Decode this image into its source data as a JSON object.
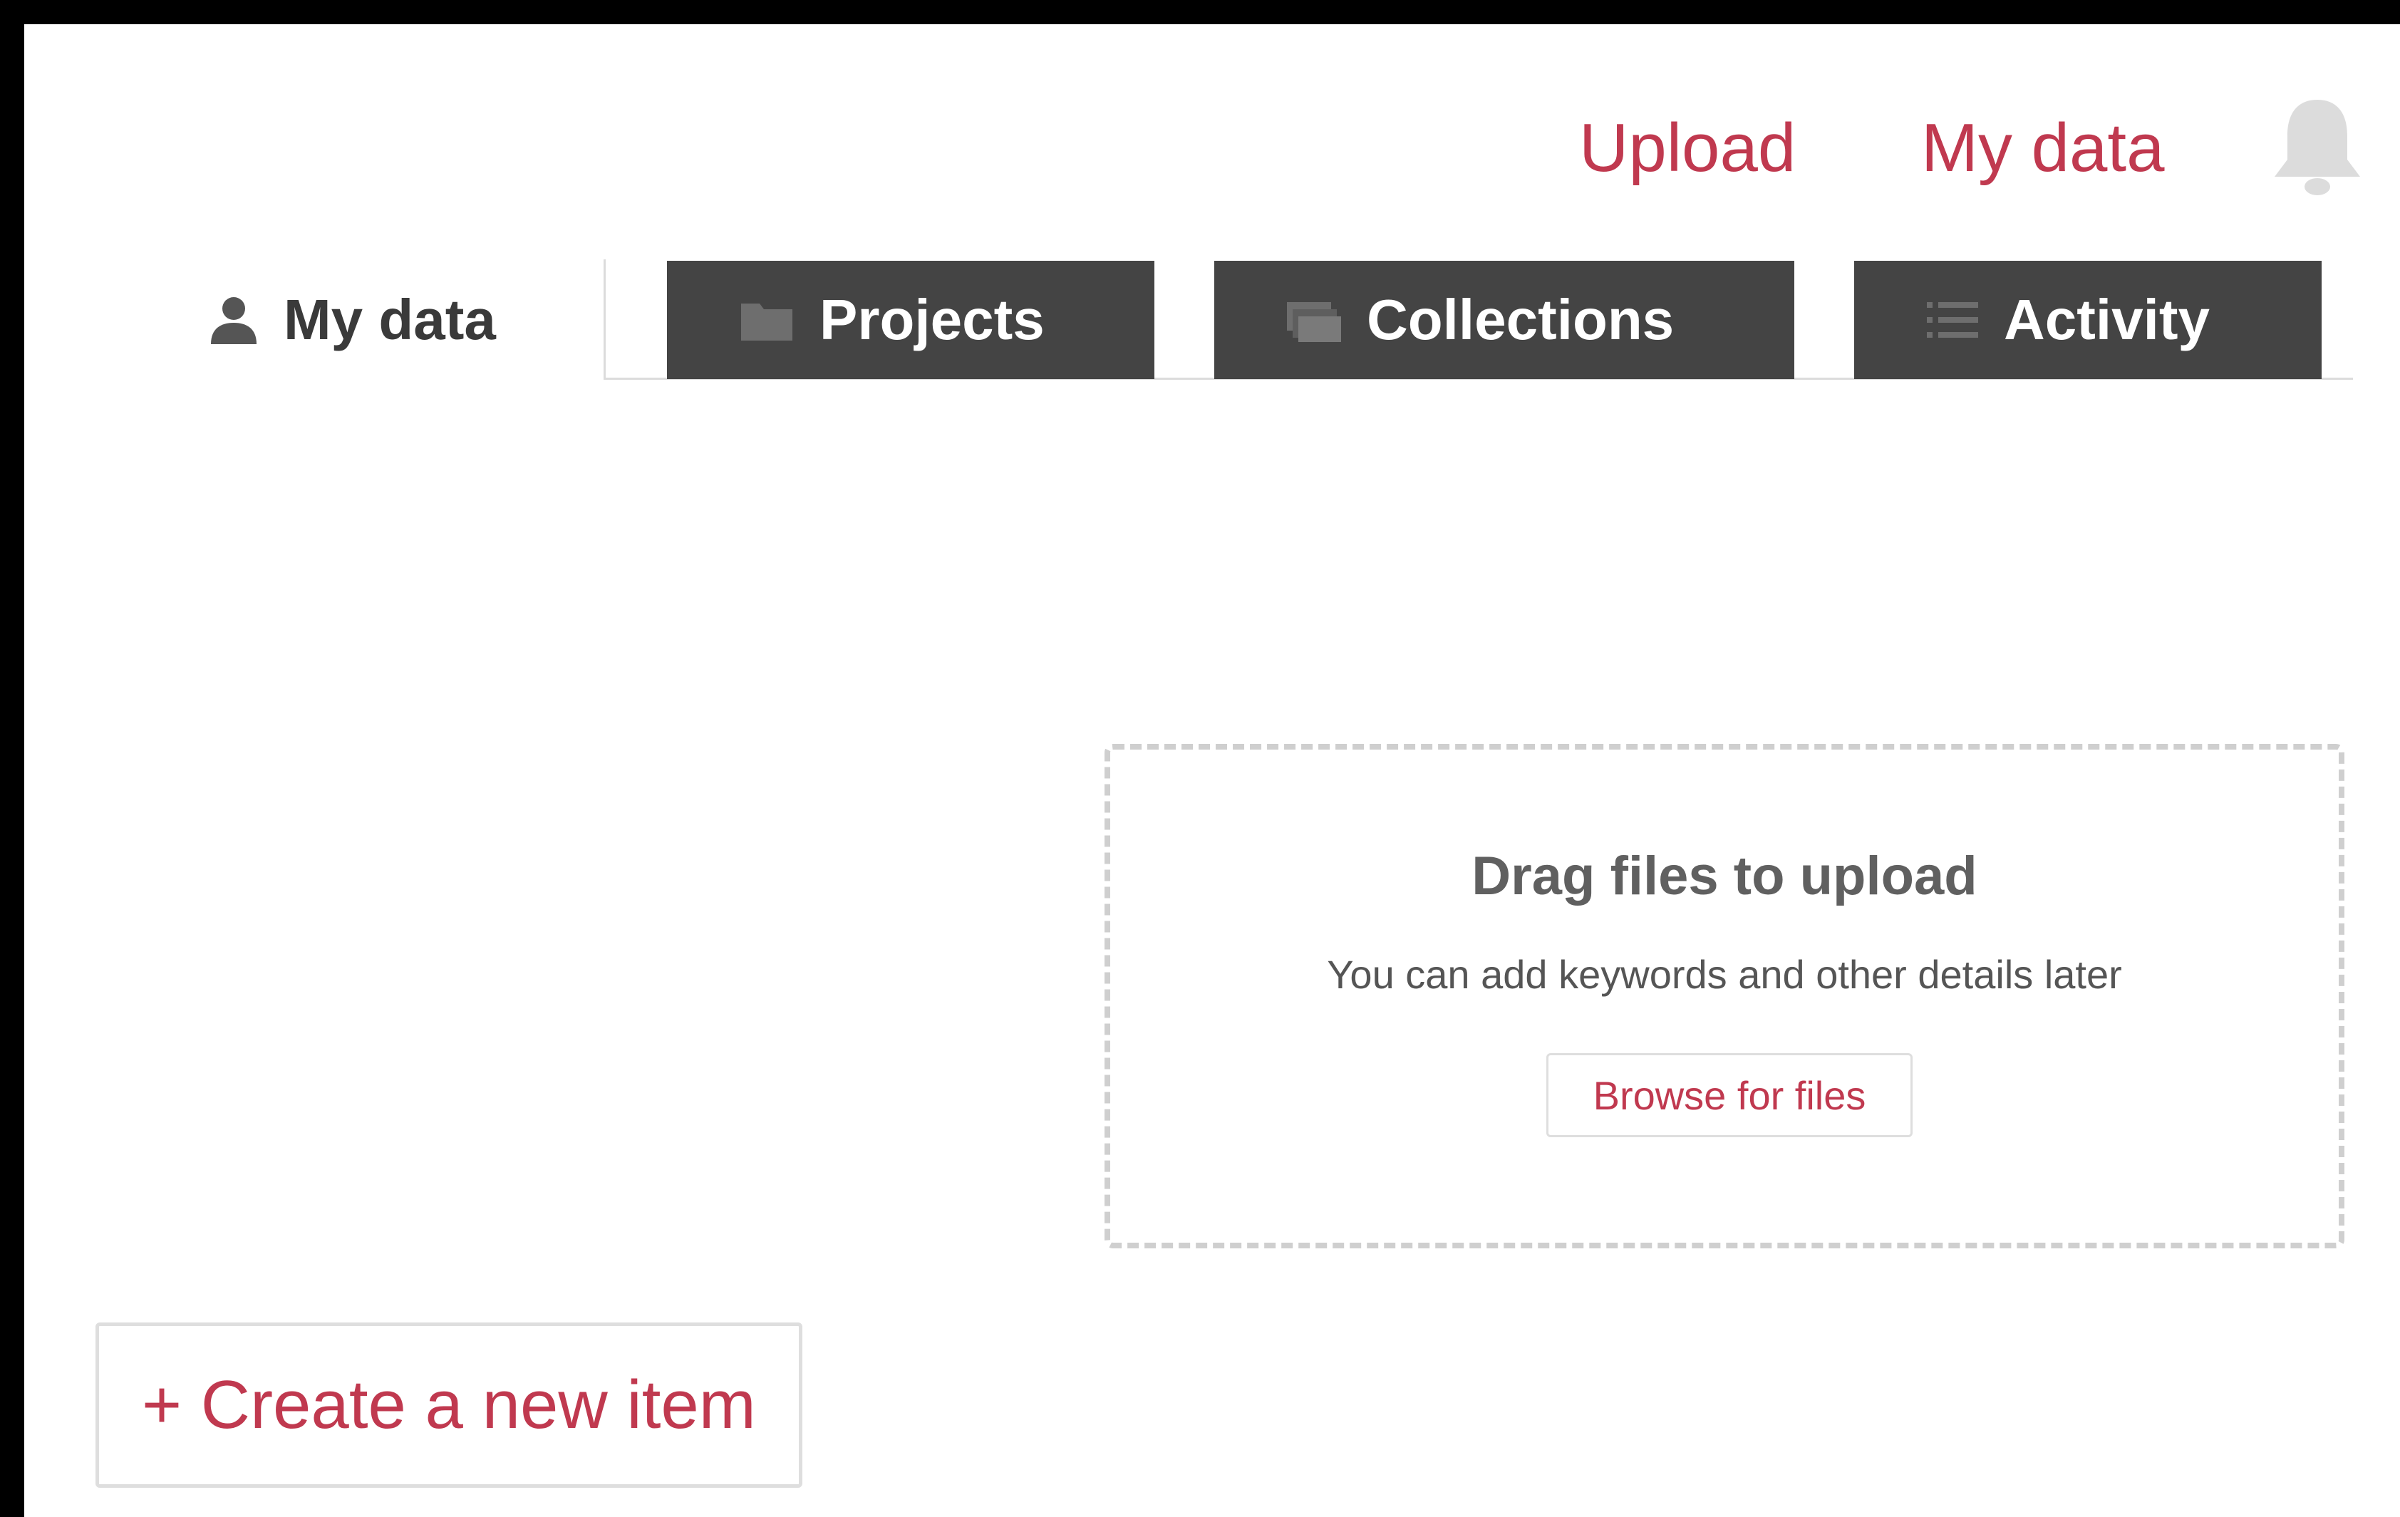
{
  "header": {
    "nav": {
      "upload_label": "Upload",
      "my_data_label": "My data"
    },
    "notification_icon": "bell-icon"
  },
  "tabs": [
    {
      "label": "My data",
      "icon": "user-icon",
      "active": true
    },
    {
      "label": "Projects",
      "icon": "folder-icon",
      "active": false
    },
    {
      "label": "Collections",
      "icon": "collections-icon",
      "active": false
    },
    {
      "label": "Activity",
      "icon": "list-icon",
      "active": false
    }
  ],
  "dropzone": {
    "title": "Drag files to upload",
    "subtitle": "You can add keywords and other details later",
    "browse_label": "Browse for files"
  },
  "actions": {
    "create_label": "+ Create a new item"
  },
  "colors": {
    "accent": "#c0394f",
    "tab_dark": "#444444",
    "text_dark": "#3a3a3a"
  }
}
